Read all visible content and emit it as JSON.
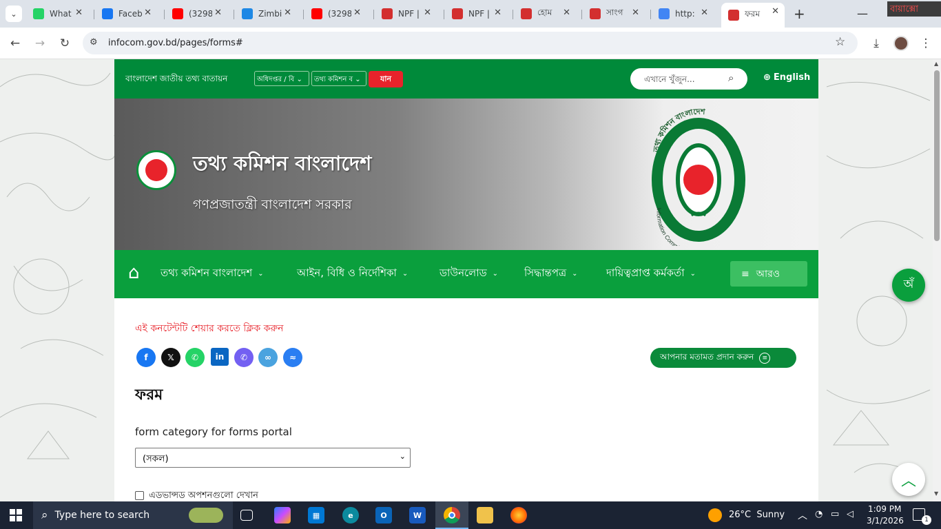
{
  "browser": {
    "tabs": [
      {
        "title": "What",
        "icon": "whatsapp-icon",
        "color": "#25d366"
      },
      {
        "title": "Faceb",
        "icon": "facebook-icon",
        "color": "#1877f2"
      },
      {
        "title": "(3298",
        "icon": "youtube-icon",
        "color": "#ff0000"
      },
      {
        "title": "Zimbi",
        "icon": "zimbra-icon",
        "color": "#1e88e5"
      },
      {
        "title": "(3298",
        "icon": "youtube-icon",
        "color": "#ff0000"
      },
      {
        "title": "NPF |",
        "icon": "bd-govt-icon",
        "color": "#d32f2f"
      },
      {
        "title": "NPF |",
        "icon": "bd-govt-icon",
        "color": "#d32f2f"
      },
      {
        "title": "হোম",
        "icon": "bd-govt-icon",
        "color": "#d32f2f"
      },
      {
        "title": "সাংগ",
        "icon": "bd-govt-icon",
        "color": "#d32f2f"
      },
      {
        "title": "http:",
        "icon": "google-icon",
        "color": "#4285f4"
      },
      {
        "title": "ফরম",
        "icon": "bd-govt-icon",
        "color": "#d32f2f",
        "active": true
      }
    ],
    "new_tab": "+",
    "corner_badge": "বায়াক্সো",
    "url": "infocom.gov.bd/pages/forms#"
  },
  "site": {
    "portal_name": "বাংলাদেশ জাতীয় তথ্য বাতায়ন",
    "select_office": "অধিদপ্তর / বি",
    "select_site": "তথ্য কমিশন ব",
    "go_button": "যান",
    "search_placeholder": "এখানে খুঁজুন...",
    "language": "English",
    "title": "তথ্য কমিশন বাংলাদেশ",
    "subtitle": "গণপ্রজাতন্ত্রী বাংলাদেশ সরকার",
    "logo_top_text": "তথ্য কমিশন বাংলাদেশ",
    "logo_bottom_text": "Information Commission Bangladesh",
    "menu": [
      "তথ্য কমিশন বাংলাদেশ",
      "আইন, বিধি ও নির্দেশিকা",
      "ডাউনলোড",
      "সিদ্ধান্তপত্র",
      "দায়িত্বপ্রাপ্ত কর্মকর্তা"
    ],
    "more_button": "আরও",
    "share_prompt": "এই কনটেন্টটি শেয়ার করতে ক্লিক করুন",
    "feedback_button": "আপনার মতামত প্রদান করুন",
    "page_heading": "ফরম",
    "category_label": "form category for forms portal",
    "category_value": "(সকল)",
    "advanced_label": "এডভান্সড অপশনগুলো দেখান",
    "accessibility_icon": "অঁ"
  },
  "taskbar": {
    "search_placeholder": "Type here to search",
    "weather": "26°C  Sunny",
    "time": "1:09 PM",
    "date": "3/1/2026",
    "notifications": "1"
  }
}
